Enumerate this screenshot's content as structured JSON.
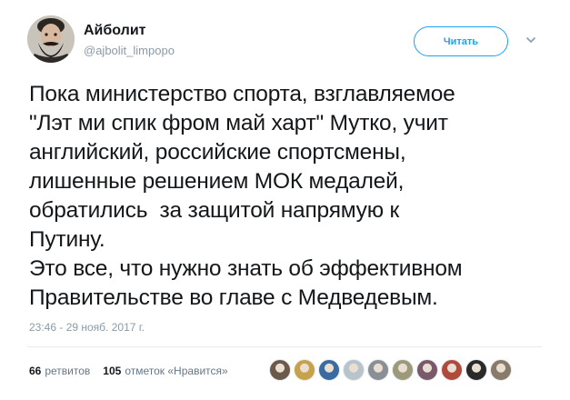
{
  "author": {
    "name": "Айболит",
    "handle": "@ajbolit_limpopo"
  },
  "follow_button": {
    "label": "Читать"
  },
  "icons": {
    "menu": "chevron-down-icon",
    "avatar": "bearded-man-avatar"
  },
  "tweet": {
    "lines": [
      "Пока министерство спорта, взглавляемое",
      "\"Лэт ми спик фром май харт\" Мутко, учит",
      "английский, российские спортсмены,",
      "лишенные решением МОК медалей,",
      "обратились  за защитой напрямую к",
      "Путину.",
      "Это все, что нужно знать об эффективном",
      "Правительстве во главе с Медведевым."
    ],
    "timestamp": "23:46 - 29 нояб. 2017 г."
  },
  "stats": {
    "retweets_count": "66",
    "retweets_label": "ретвитов",
    "likes_count": "105",
    "likes_label": "отметок «Нравится»"
  },
  "likers": [
    "#6b5a4a",
    "#c8a24a",
    "#3a6aa0",
    "#b8c4cc",
    "#8a8f95",
    "#9c9a7a",
    "#7a5a6a",
    "#b04a3a",
    "#2a2a2a",
    "#8a7a6a"
  ],
  "colors": {
    "accent": "#1da1f2",
    "text": "#14171a",
    "muted": "#8a9aa8",
    "divider": "#e6ecf0"
  }
}
